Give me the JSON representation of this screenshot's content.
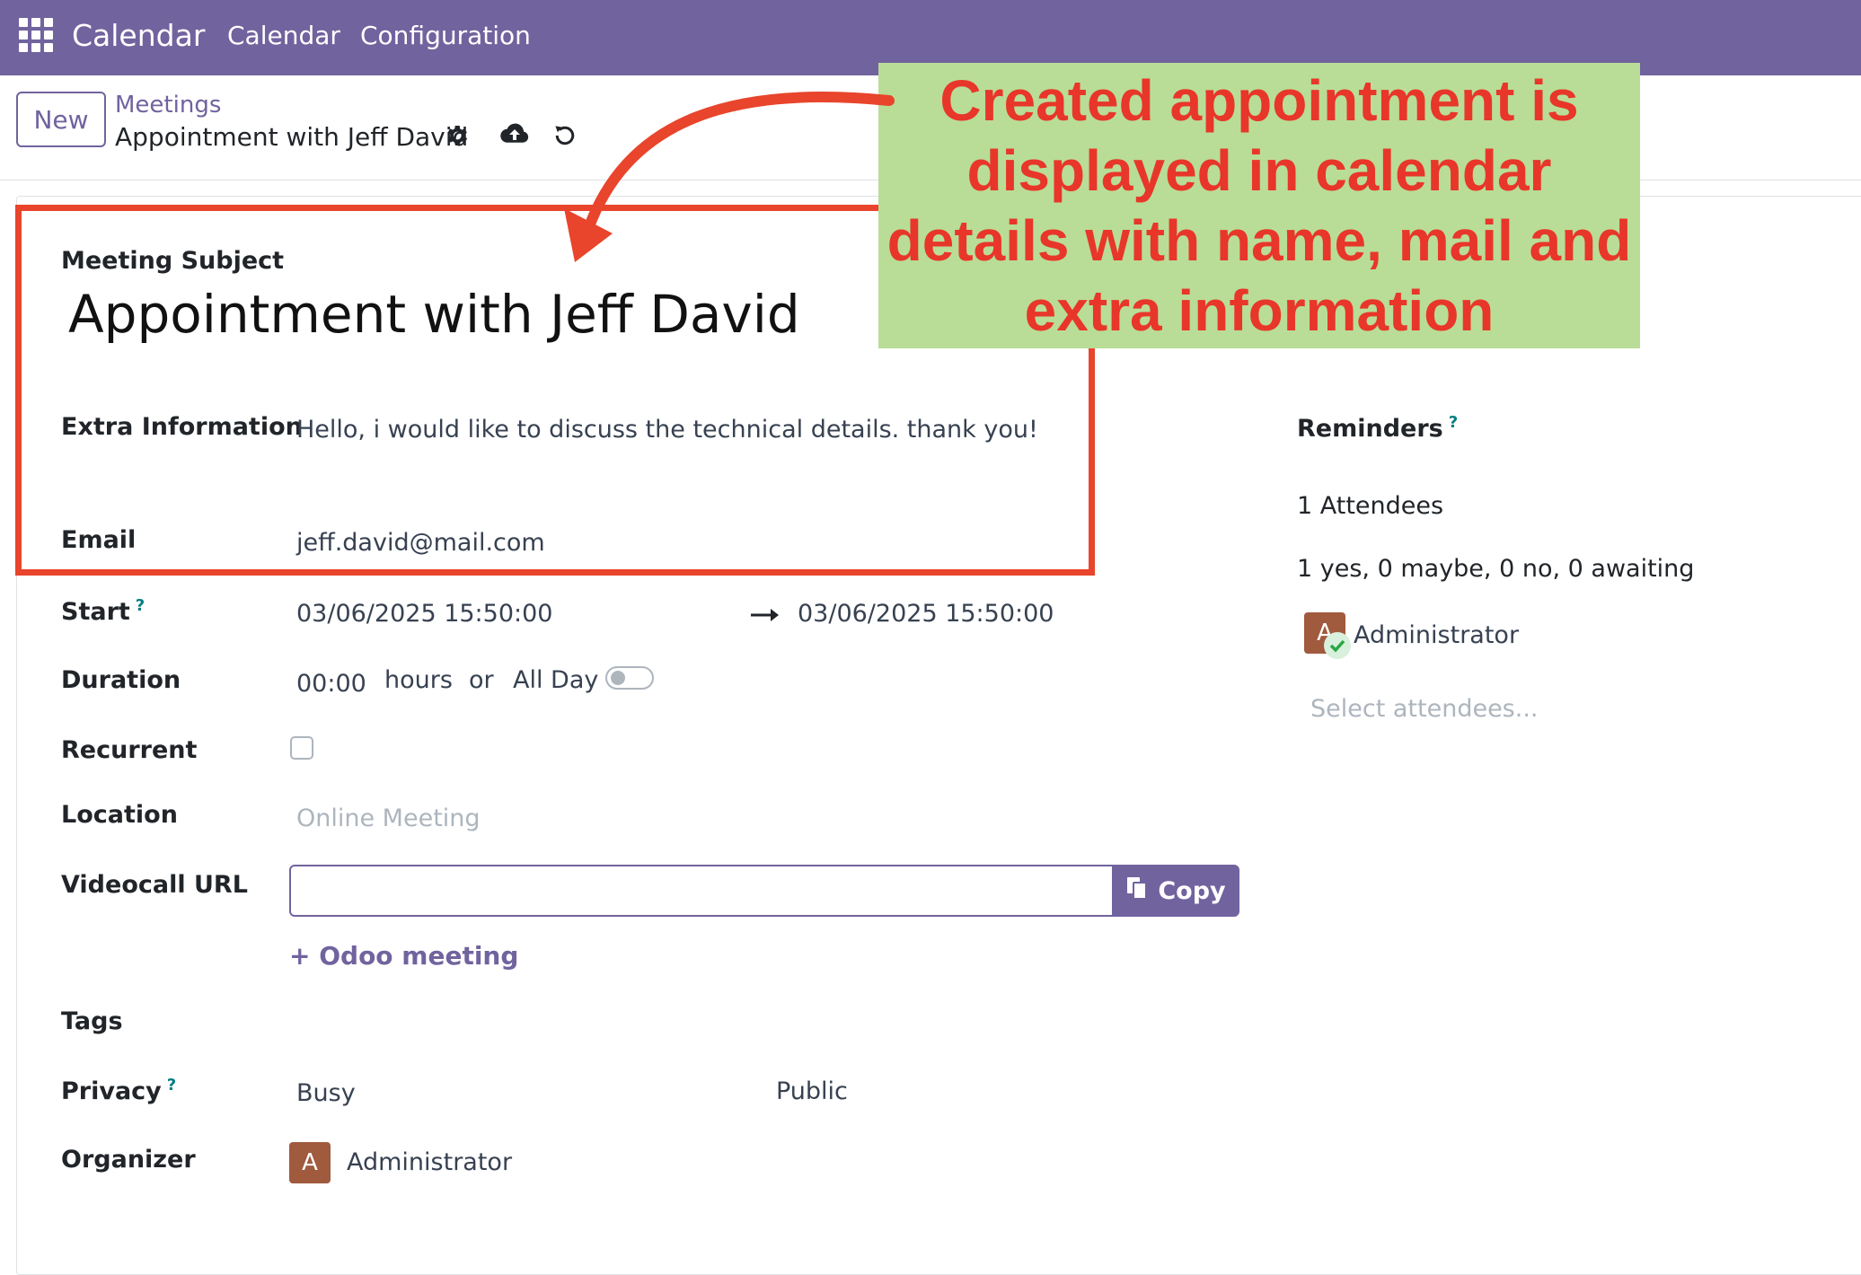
{
  "navbar": {
    "app_name": "Calendar",
    "menu": [
      "Calendar",
      "Configuration"
    ],
    "color": "#71639e"
  },
  "control_panel": {
    "new_label": "New",
    "breadcrumb_parent": "Meetings",
    "breadcrumb_current": "Appointment with Jeff David",
    "icons": [
      "gear-icon",
      "cloud-upload-icon",
      "discard-icon"
    ]
  },
  "form": {
    "subject_label": "Meeting Subject",
    "subject_value": "Appointment with Jeff David",
    "extra_info_label": "Extra Information",
    "extra_info_value": "Hello, i would like to discuss the technical details. thank you!",
    "email_label": "Email",
    "email_value": "jeff.david@mail.com",
    "start_label": "Start",
    "start_value": "03/06/2025 15:50:00",
    "stop_value": "03/06/2025 15:50:00",
    "duration_label": "Duration",
    "duration_value": "00:00",
    "hours_text": "hours",
    "or_text": "or",
    "allday_label": "All Day",
    "allday_on": false,
    "recurrent_label": "Recurrent",
    "recurrent_checked": false,
    "location_label": "Location",
    "location_placeholder": "Online Meeting",
    "videocall_label": "Videocall URL",
    "videocall_value": "",
    "copy_label": "Copy",
    "odoo_meeting_label": "Odoo meeting",
    "tags_label": "Tags",
    "privacy_label": "Privacy",
    "show_as_value": "Busy",
    "privacy_value": "Public",
    "organizer_label": "Organizer",
    "organizer_initial": "A",
    "organizer_name": "Administrator",
    "help_mark": "?"
  },
  "side": {
    "reminders_label": "Reminders",
    "attendees_count": "1 Attendees",
    "attendees_summary": "1 yes, 0 maybe, 0 no, 0 awaiting",
    "attendee_initial": "A",
    "attendee_name": "Administrator",
    "select_placeholder": "Select attendees..."
  },
  "annotation": {
    "callout_text": "Created appointment is displayed in calendar details with name, mail and extra information",
    "callout_bg": "#b9dd96",
    "callout_fg": "#e8362a",
    "box_color": "#e8452c"
  }
}
